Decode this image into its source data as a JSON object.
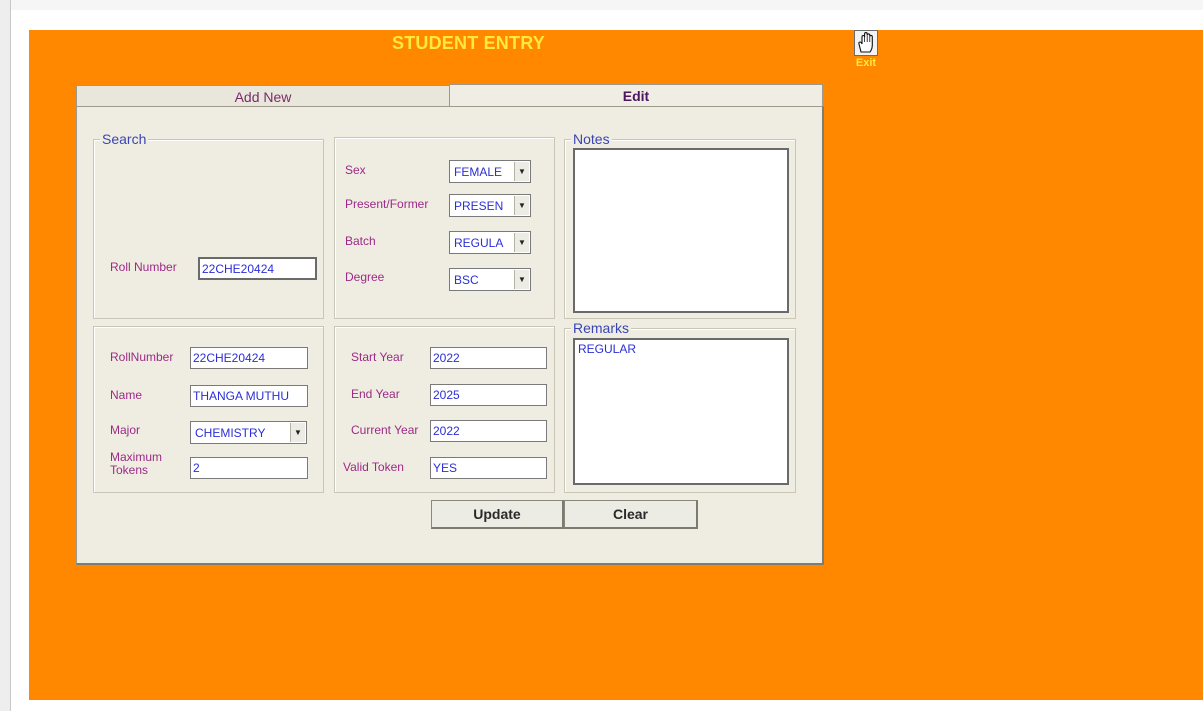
{
  "title": "STUDENT ENTRY",
  "exit": {
    "label": "Exit",
    "icon": "hand-icon"
  },
  "tabs": {
    "add_new": "Add New",
    "edit": "Edit"
  },
  "search": {
    "legend": "Search",
    "roll_number_label": "Roll Number",
    "roll_number_value": "22CHE20424"
  },
  "filters": {
    "sex": {
      "label": "Sex",
      "value": "FEMALE"
    },
    "present_former": {
      "label": "Present/Former",
      "value": "PRESEN"
    },
    "batch": {
      "label": "Batch",
      "value": "REGULA"
    },
    "degree": {
      "label": "Degree",
      "value": "BSC"
    }
  },
  "notes": {
    "legend": "Notes",
    "value": ""
  },
  "details": {
    "rollnumber": {
      "label": "RollNumber",
      "value": "22CHE20424"
    },
    "name": {
      "label": "Name",
      "value": "THANGA MUTHU"
    },
    "major": {
      "label": "Major",
      "value": "CHEMISTRY"
    },
    "max_tokens": {
      "label": "Maximum Tokens",
      "value": "2"
    }
  },
  "years": {
    "start_year": {
      "label": "Start Year",
      "value": "2022"
    },
    "end_year": {
      "label": "End Year",
      "value": "2025"
    },
    "current_year": {
      "label": "Current Year",
      "value": "2022"
    },
    "valid_token": {
      "label": "Valid Token",
      "value": "YES"
    }
  },
  "remarks": {
    "legend": "Remarks",
    "value": "REGULAR"
  },
  "buttons": {
    "update": "Update",
    "clear": "Clear"
  },
  "colors": {
    "background": "#ff8800",
    "title": "#ffe93a",
    "panel": "#efede2",
    "label": "#9c2a86",
    "value": "#2b2fd6"
  }
}
